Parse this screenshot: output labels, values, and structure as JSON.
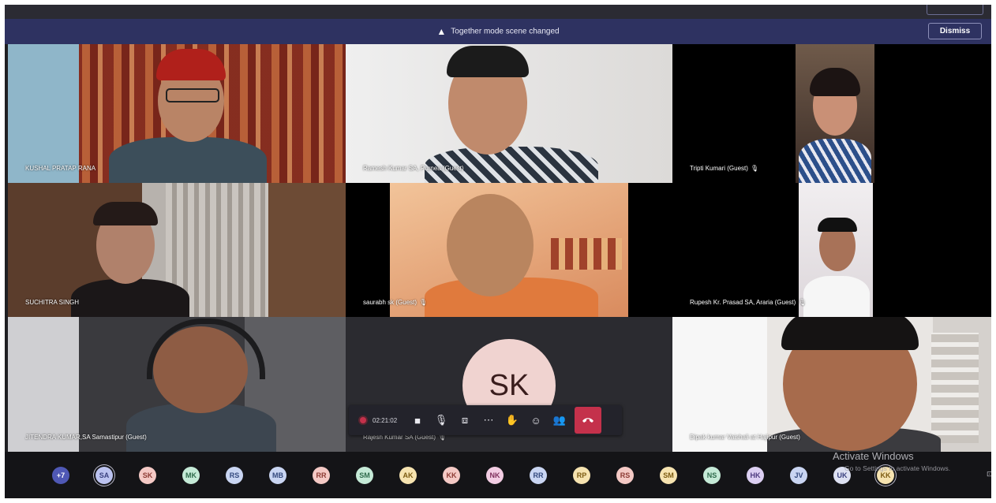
{
  "banner": {
    "icon": "warning-icon",
    "message": "Together mode scene changed",
    "dismiss_label": "Dismiss"
  },
  "participants": [
    {
      "name": "KUSHAL PRATAP RANA",
      "mic": false
    },
    {
      "name": "Ramesh Kumar SA, Purnea (Guest)",
      "mic": false
    },
    {
      "name": "Tripti Kumari (Guest)",
      "mic": true
    },
    {
      "name": "SUCHITRA SINGH",
      "mic": false
    },
    {
      "name": "saurabh sk (Guest)",
      "mic": true
    },
    {
      "name": "Rupesh Kr. Prasad SA, Araria (Guest)",
      "mic": true
    },
    {
      "name": "JITENDRA KUMAR,SA Samastipur (Guest)",
      "mic": false
    },
    {
      "name": "Rajesh Kumar SA (Guest)",
      "mic": true,
      "initials": "SK"
    },
    {
      "name": "Dipak kumar Vaishali at Hajipur (Guest)",
      "mic": false
    }
  ],
  "call_controls": {
    "timer": "02:21:02",
    "icons": [
      "camera-icon",
      "microphone-icon",
      "share-screen-icon",
      "more-options-icon",
      "raise-hand-icon",
      "chat-icon",
      "participants-icon",
      "hang-up-icon"
    ]
  },
  "together_row": {
    "overflow": "+7",
    "avatars": [
      {
        "initials": "SA",
        "color": "#bcc3f0",
        "text": "#3b4280"
      },
      {
        "initials": "SK",
        "color": "#f4c9c5",
        "text": "#8c3a33"
      },
      {
        "initials": "MK",
        "color": "#c5ead7",
        "text": "#2f6b4c"
      },
      {
        "initials": "RS",
        "color": "#c9d5f2",
        "text": "#33497d"
      },
      {
        "initials": "MB",
        "color": "#c9d5f2",
        "text": "#33497d"
      },
      {
        "initials": "RR",
        "color": "#f4c9c5",
        "text": "#8c3a33"
      },
      {
        "initials": "SM",
        "color": "#c5ead7",
        "text": "#2f6b4c"
      },
      {
        "initials": "AK",
        "color": "#f6e3b0",
        "text": "#7c5b12"
      },
      {
        "initials": "KK",
        "color": "#f4c9c5",
        "text": "#8c3a33"
      },
      {
        "initials": "NK",
        "color": "#f3cde3",
        "text": "#7f2f5c"
      },
      {
        "initials": "RR",
        "color": "#c9d5f2",
        "text": "#33497d"
      },
      {
        "initials": "RP",
        "color": "#f6e3b0",
        "text": "#7c5b12"
      },
      {
        "initials": "RS",
        "color": "#f4c9c5",
        "text": "#8c3a33"
      },
      {
        "initials": "SM",
        "color": "#f6e3b0",
        "text": "#7c5b12"
      },
      {
        "initials": "NS",
        "color": "#c5ead7",
        "text": "#2f6b4c"
      },
      {
        "initials": "HK",
        "color": "#dccff2",
        "text": "#4e3a80"
      },
      {
        "initials": "JV",
        "color": "#c9d5f2",
        "text": "#33497d"
      },
      {
        "initials": "UK",
        "color": "#dde1f2",
        "text": "#3b4280"
      },
      {
        "initials": "KK",
        "color": "#f6e3b0",
        "text": "#7c5b12"
      }
    ]
  },
  "watermark": {
    "title": "Activate Windows",
    "subtitle": "Go to Settings to activate Windows."
  }
}
